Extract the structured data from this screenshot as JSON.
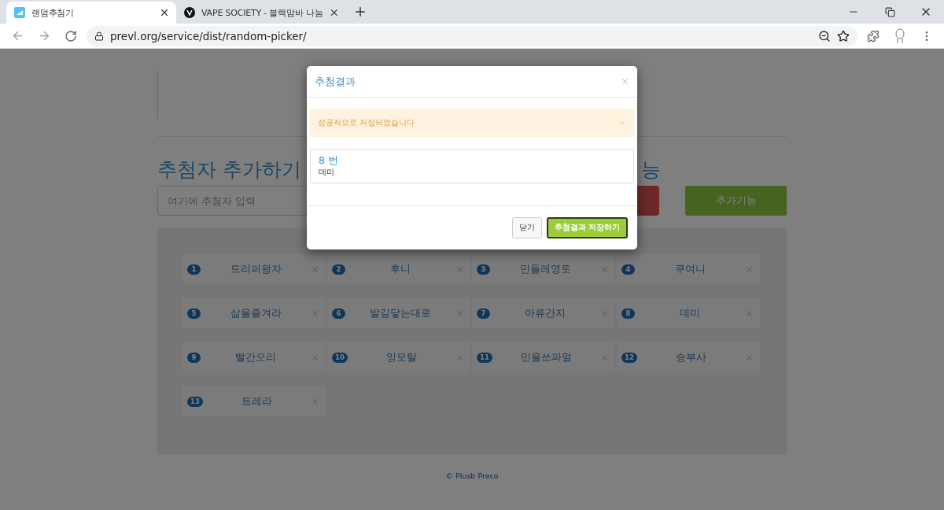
{
  "browser": {
    "tabs": [
      {
        "title": "랜덤추첨기",
        "kind": "picker",
        "selected": true
      },
      {
        "title": "VAPE SOCIETY - 블랙맘바 나눔",
        "kind": "letter",
        "selected": false
      }
    ],
    "address": "prevl.org/service/dist/random-picker/"
  },
  "page": {
    "heading": "추첨자 추가하기",
    "heading_right": "능",
    "input_placeholder": "여기에 추첨자 입력",
    "add_button": "추가기능",
    "entries": [
      {
        "number": "1",
        "name": "드리퍼왕자"
      },
      {
        "number": "2",
        "name": "후니"
      },
      {
        "number": "3",
        "name": "민들레영토"
      },
      {
        "number": "4",
        "name": "쿠여니"
      },
      {
        "number": "5",
        "name": "삶을즐겨라"
      },
      {
        "number": "6",
        "name": "발길닿는대로"
      },
      {
        "number": "7",
        "name": "아류간지"
      },
      {
        "number": "8",
        "name": "데미"
      },
      {
        "number": "9",
        "name": "빨간오리"
      },
      {
        "number": "10",
        "name": "잉모탈"
      },
      {
        "number": "11",
        "name": "민을쓰파멀"
      },
      {
        "number": "12",
        "name": "승부사"
      },
      {
        "number": "13",
        "name": "트레라"
      }
    ],
    "footer": "© Plusb Preco"
  },
  "modal": {
    "title": "추첨결과",
    "alert": "성공적으로 저장되었습니다",
    "result": {
      "number": "8 번",
      "name": "데미"
    },
    "buttons": [
      {
        "label": "닫기",
        "kind": "default"
      },
      {
        "label": "추첨결과 저장하기",
        "kind": "primary"
      }
    ]
  }
}
